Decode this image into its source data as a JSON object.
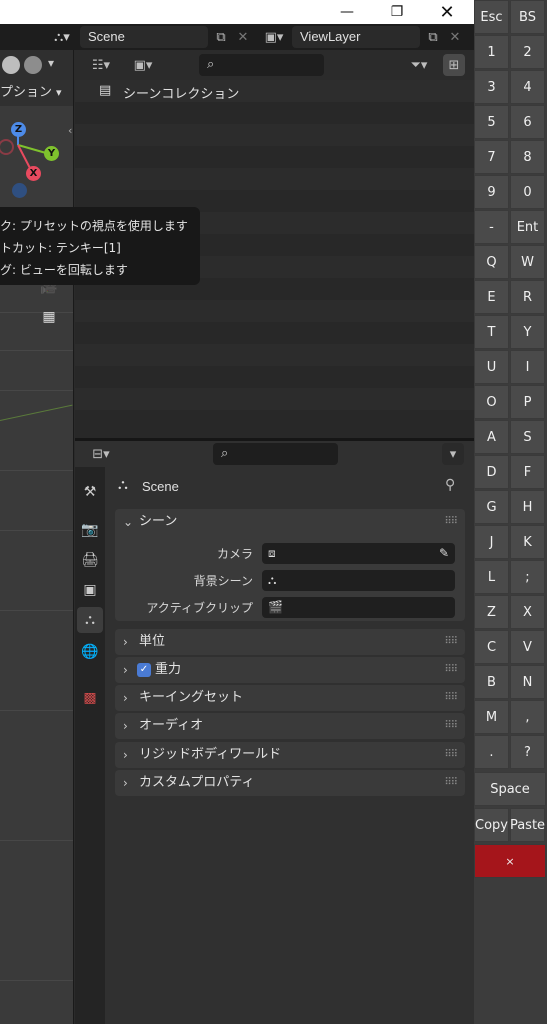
{
  "window": {
    "minimize": "—",
    "maximize": "❐",
    "close": "✕"
  },
  "topbar": {
    "scene": "Scene",
    "view_layer": "ViewLayer"
  },
  "viewport": {
    "header_text": "プション",
    "gizmo": {
      "z": "Z",
      "y": "Y",
      "x": "X"
    },
    "tooltip": [
      "ク: プリセットの視点を使用します",
      "トカット: テンキー[1]",
      "グ: ビューを回転します"
    ]
  },
  "outliner": {
    "collection": "シーンコレクション"
  },
  "properties": {
    "context": "Scene",
    "scene_panel": {
      "title": "シーン",
      "fields": [
        {
          "label": "カメラ"
        },
        {
          "label": "背景シーン"
        },
        {
          "label": "アクティブクリップ"
        }
      ]
    },
    "panels": [
      {
        "title": "単位",
        "checkbox": false
      },
      {
        "title": "重力",
        "checkbox": true
      },
      {
        "title": "キーイングセット",
        "checkbox": false
      },
      {
        "title": "オーディオ",
        "checkbox": false
      },
      {
        "title": "リジッドボディワールド",
        "checkbox": false
      },
      {
        "title": "カスタムプロパティ",
        "checkbox": false
      }
    ]
  },
  "keypad": {
    "rows": [
      [
        "Esc",
        "BS"
      ],
      [
        "1",
        "2"
      ],
      [
        "3",
        "4"
      ],
      [
        "5",
        "6"
      ],
      [
        "7",
        "8"
      ],
      [
        "9",
        "0"
      ],
      [
        "-",
        "Ent"
      ],
      [
        "Q",
        "W"
      ],
      [
        "E",
        "R"
      ],
      [
        "T",
        "Y"
      ],
      [
        "U",
        "I"
      ],
      [
        "O",
        "P"
      ],
      [
        "A",
        "S"
      ],
      [
        "D",
        "F"
      ],
      [
        "G",
        "H"
      ],
      [
        "J",
        "K"
      ],
      [
        "L",
        ";"
      ],
      [
        "Z",
        "X"
      ],
      [
        "C",
        "V"
      ],
      [
        "B",
        "N"
      ],
      [
        "M",
        ","
      ],
      [
        ".",
        "?"
      ]
    ],
    "space": "Space",
    "copy": "Copy",
    "paste": "Paste",
    "close": "×"
  },
  "colors": {
    "accent_blue": "#4a7bd4",
    "keypad_close": "#a5151b"
  }
}
